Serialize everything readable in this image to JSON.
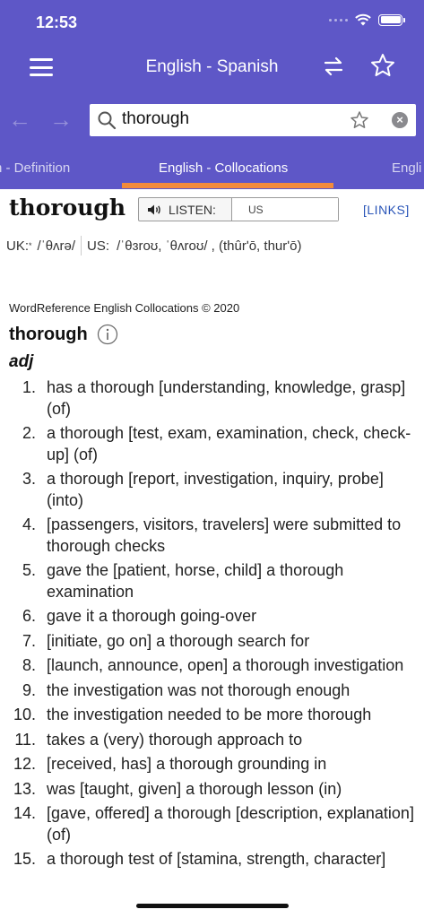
{
  "status": {
    "time": "12:53"
  },
  "nav": {
    "title": "English - Spanish",
    "menu_icon": "hamburger-menu-icon",
    "swap_icon": "swap-arrows-icon",
    "favorite_icon": "star-icon"
  },
  "search": {
    "value": "thorough",
    "back_icon": "arrow-left-icon",
    "forward_icon": "arrow-right-icon"
  },
  "tabs": [
    {
      "label": "n - Definition"
    },
    {
      "label": "English - Collocations",
      "active": true
    },
    {
      "label": "Engli"
    }
  ],
  "entry": {
    "headword": "thorough",
    "listen_label": "LISTEN:",
    "accent_option": "US",
    "links_label": "[LINKS]",
    "uk_label": "UK:",
    "uk_marker": "*",
    "uk_pron": "/ˈθʌrə/",
    "us_label": "US:",
    "us_pron": "/ˈθɜroʊ, ˈθʌroʊ/ , (thûrʹō, thurʹō)",
    "copyright": "WordReference English Collocations © 2020",
    "word": "thorough",
    "pos": "adj",
    "collocations": [
      {
        "num": "1.",
        "text": "has a thorough [understanding, knowledge, grasp] (of)"
      },
      {
        "num": "2.",
        "text": "a thorough [test, exam, examination, check, check-up] (of)"
      },
      {
        "num": "3.",
        "text": "a thorough [report, investigation, inquiry, probe] (into)"
      },
      {
        "num": "4.",
        "text": "[passengers, visitors, travelers] were submitted to thorough checks"
      },
      {
        "num": "5.",
        "text": "gave the [patient, horse, child] a thorough examination"
      },
      {
        "num": "6.",
        "text": "gave it a thorough going-over"
      },
      {
        "num": "7.",
        "text": "[initiate, go on] a thorough search for"
      },
      {
        "num": "8.",
        "text": "[launch, announce, open] a thorough investigation"
      },
      {
        "num": "9.",
        "text": "the investigation was not thorough enough"
      },
      {
        "num": "10.",
        "text": "the investigation needed to be more thorough"
      },
      {
        "num": "11.",
        "text": "takes a (very) thorough approach to"
      },
      {
        "num": "12.",
        "text": "[received, has] a thorough grounding in"
      },
      {
        "num": "13.",
        "text": "was [taught, given] a thorough lesson (in)"
      },
      {
        "num": "14.",
        "text": "[gave, offered] a thorough [description, explanation] (of)"
      },
      {
        "num": "15.",
        "text": "a thorough test of [stamina, strength, character]"
      }
    ]
  },
  "colors": {
    "brand": "#5e57c7",
    "tab_indicator": "#f38b3b",
    "link": "#2a55b8"
  }
}
